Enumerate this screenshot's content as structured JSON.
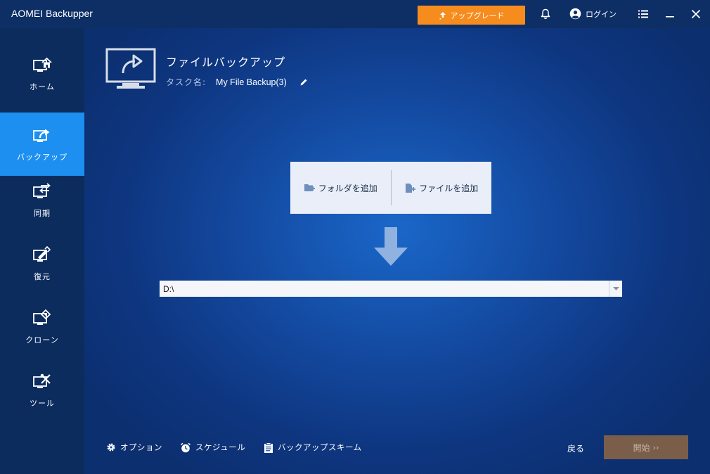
{
  "app": {
    "title": "AOMEI Backupper"
  },
  "titlebar": {
    "upgrade_label": "アップグレード",
    "login_label": "ログイン"
  },
  "sidebar": {
    "items": [
      {
        "label": "ホーム",
        "icon": "home-icon",
        "active": false
      },
      {
        "label": "バックアップ",
        "icon": "backup-icon",
        "active": true
      },
      {
        "label": "同期",
        "icon": "sync-icon",
        "active": false
      },
      {
        "label": "復元",
        "icon": "restore-icon",
        "active": false
      },
      {
        "label": "クローン",
        "icon": "clone-icon",
        "active": false
      },
      {
        "label": "ツール",
        "icon": "tools-icon",
        "active": false
      }
    ]
  },
  "main": {
    "title": "ファイルバックアップ",
    "task_label": "タスク名:",
    "task_name": "My File Backup(3)",
    "add_folder_label": "フォルダを追加",
    "add_file_label": "ファイルを追加",
    "destination_value": "D:\\"
  },
  "footer": {
    "options_label": "オプション",
    "schedule_label": "スケジュール",
    "scheme_label": "バックアップスキーム",
    "back_label": "戻る",
    "start_label": "開始"
  },
  "colors": {
    "accent": "#1c8ff0",
    "upgrade": "#f78c1e",
    "start_disabled": "#7b5e4a",
    "titlebar": "#0d2f66",
    "sidebar": "#0c2c5e"
  }
}
